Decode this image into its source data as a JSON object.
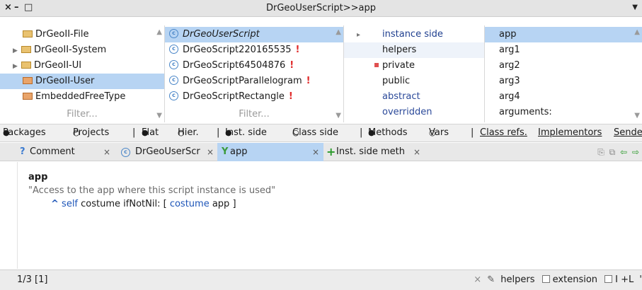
{
  "window": {
    "title": "DrGeoUserScript>>app",
    "close_glyph": "×",
    "minimize_glyph": "–",
    "maximize_glyph": "□",
    "menu_glyph": "▼"
  },
  "packages": {
    "items": [
      {
        "label": "DrGeoII-File",
        "expandable": false,
        "selected": false
      },
      {
        "label": "DrGeoII-System",
        "expandable": true,
        "selected": false
      },
      {
        "label": "DrGeoII-UI",
        "expandable": true,
        "selected": false
      },
      {
        "label": "DrGeoII-User",
        "expandable": false,
        "selected": true
      },
      {
        "label": "EmbeddedFreeType",
        "expandable": false,
        "selected": false
      }
    ],
    "filter_placeholder": "Filter..."
  },
  "classes": {
    "items": [
      {
        "label": "DrGeoUserScript",
        "italic": true,
        "warning": false,
        "selected": true
      },
      {
        "label": "DrGeoScript220165535",
        "italic": false,
        "warning": true,
        "selected": false
      },
      {
        "label": "DrGeoScript64504876",
        "italic": false,
        "warning": true,
        "selected": false
      },
      {
        "label": "DrGeoScriptParallelogram",
        "italic": false,
        "warning": true,
        "selected": false
      },
      {
        "label": "DrGeoScriptRectangle",
        "italic": false,
        "warning": true,
        "selected": false
      }
    ],
    "warning_glyph": "!",
    "class_icon_letter": "c",
    "filter_placeholder": "Filter..."
  },
  "protocols": {
    "items": [
      {
        "label": "instance side",
        "marker": "▸",
        "style": "navy"
      },
      {
        "label": "helpers",
        "marker": "",
        "style": "plain"
      },
      {
        "label": "private",
        "marker": "square",
        "style": "plain"
      },
      {
        "label": "public",
        "marker": "",
        "style": "plain"
      },
      {
        "label": "abstract",
        "marker": "",
        "style": "navy"
      },
      {
        "label": "overridden",
        "marker": "",
        "style": "navy"
      }
    ]
  },
  "methods": {
    "items": [
      {
        "label": "app",
        "selected": true
      },
      {
        "label": "arg1",
        "selected": false
      },
      {
        "label": "arg2",
        "selected": false
      },
      {
        "label": "arg3",
        "selected": false
      },
      {
        "label": "arg4",
        "selected": false
      },
      {
        "label": "arguments:",
        "selected": false
      }
    ]
  },
  "toolbar": {
    "packages": "Packages",
    "projects": "Projects",
    "flat": "Flat",
    "hier": "Hier.",
    "inst_side": "Inst. side",
    "class_side": "Class side",
    "methods": "Methods",
    "vars": "Vars",
    "class_refs": "Class refs.",
    "implementors": "Implementors",
    "senders": "Sende",
    "sep": "|",
    "radio_on": "●",
    "radio_off": "○"
  },
  "tabs": [
    {
      "icon": "?",
      "label": "Comment",
      "close": "×"
    },
    {
      "icon": "c",
      "label": "DrGeoUserScr",
      "close": "×"
    },
    {
      "icon": "Y",
      "label": "app",
      "close": "×"
    },
    {
      "icon": "+",
      "label": "Inst. side meth",
      "close": "×"
    }
  ],
  "tab_tools": {
    "copy": "⎘",
    "new": "⧉",
    "back": "⇦",
    "forward": "⇨"
  },
  "code": {
    "selector": "app",
    "comment": "\"Access to the app where this script instance is used\"",
    "caret": "^",
    "self": "self",
    "costume1": "costume",
    "ifnotnil": "ifNotNil:",
    "bracket_open": "[",
    "costume2": "costume",
    "app": "app",
    "bracket_close": "]"
  },
  "status": {
    "position": "1/3 [1]",
    "close": "×",
    "pencil": "✎",
    "helpers": "helpers",
    "extension": "extension",
    "il": "I +L",
    "tail": "'"
  },
  "colors": {
    "selection": "#b7d4f3",
    "warning": "#e02a2a",
    "keyword": "#1d55b8"
  }
}
